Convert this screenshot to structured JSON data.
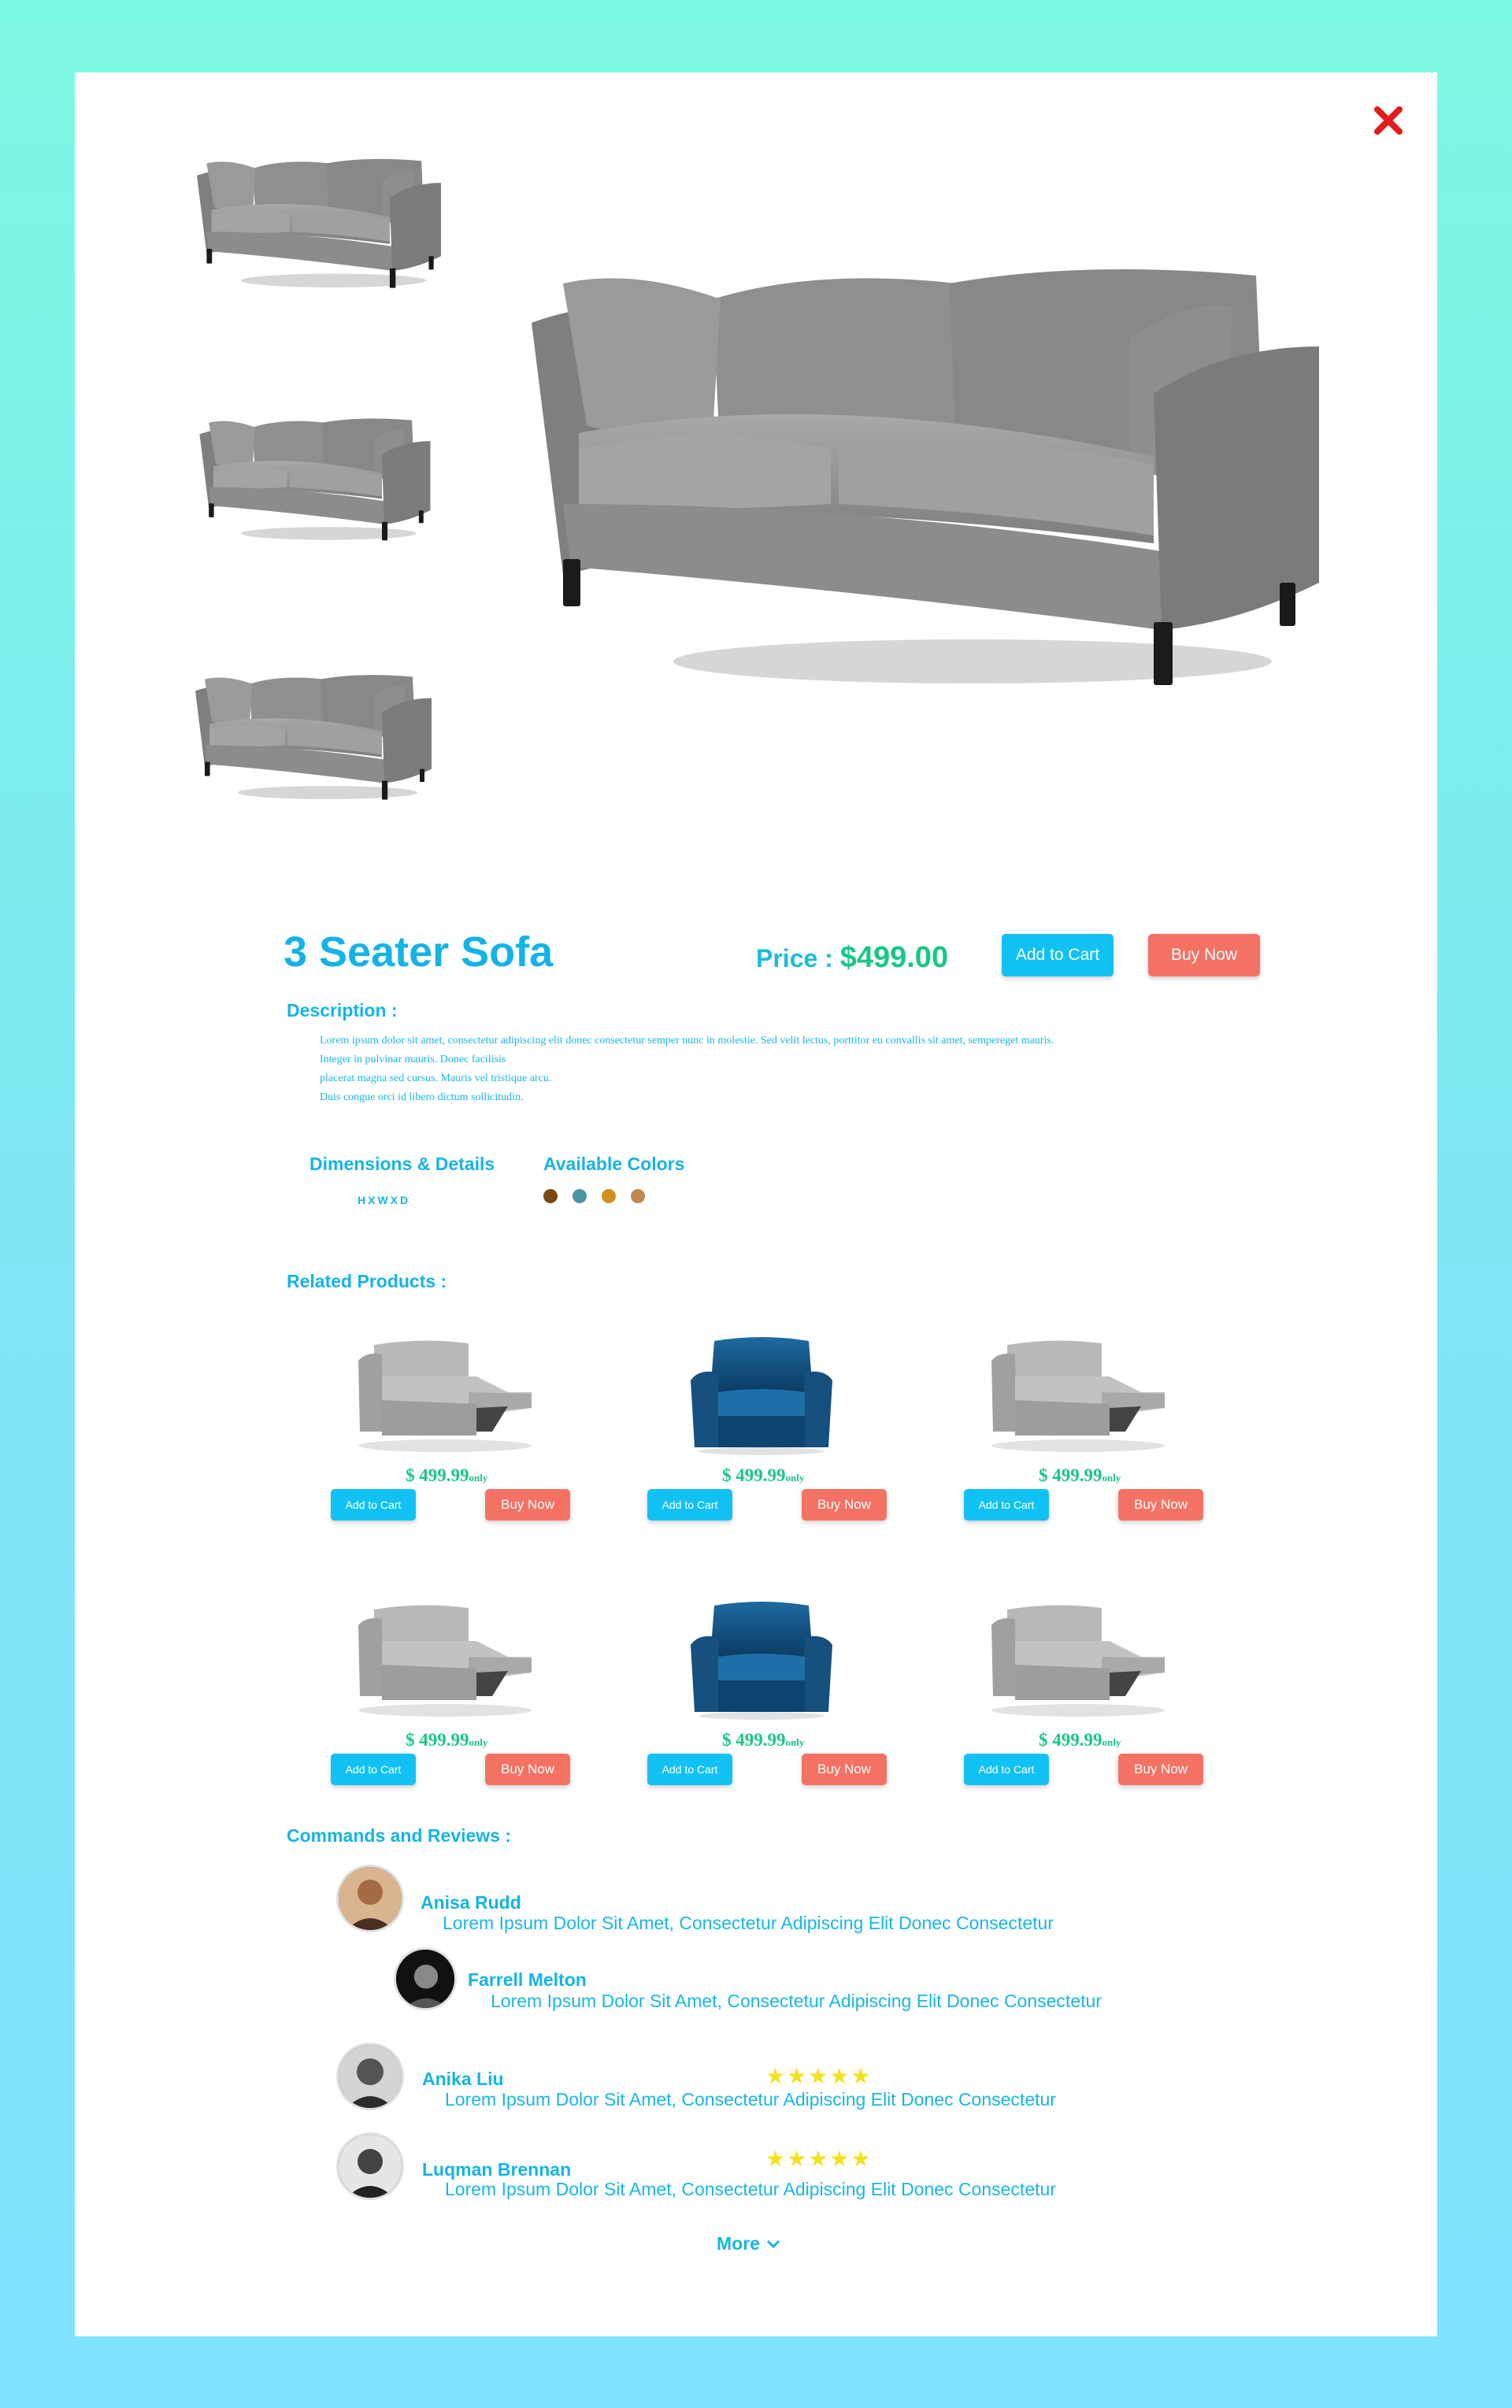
{
  "product": {
    "title": "3 Seater Sofa",
    "price_label": "Price : ",
    "price_value": "$499.00",
    "add_to_cart": "Add to Cart",
    "buy_now": "Buy Now"
  },
  "description": {
    "heading": "Description :",
    "lines": [
      "Lorem ipsum dolor sit amet, consectetur adipiscing elit donec consectetur semper nunc in molestie. Sed velit lectus, porttitor eu convallis sit amet, sempereget mauris.",
      "Integer in pulvinar mauris. Donec facilisis",
      "placerat magna sed cursus. Mauris vel tristique arcu.",
      "Duis congue orci id libero dictum sollicitudin."
    ]
  },
  "details": {
    "dimensions_heading": "Dimensions & Details",
    "dimensions_value": "HXWXD",
    "colors_heading": "Available Colors",
    "colors": [
      "#7a4a14",
      "#4a93a6",
      "#d38f1b",
      "#bf8a52"
    ]
  },
  "related": {
    "heading": "Related Products :",
    "items": [
      {
        "image": "recliner-sofa-grey",
        "price": "$ 499.99",
        "suffix": "only",
        "cart": "Add to Cart",
        "buy": "Buy Now"
      },
      {
        "image": "armchair-blue",
        "price": "$ 499.99",
        "suffix": "only",
        "cart": "Add to Cart",
        "buy": "Buy Now"
      },
      {
        "image": "recliner-sofa-grey",
        "price": "$ 499.99",
        "suffix": "only",
        "cart": "Add to Cart",
        "buy": "Buy Now"
      },
      {
        "image": "recliner-sofa-grey",
        "price": "$ 499.99",
        "suffix": "only",
        "cart": "Add to Cart",
        "buy": "Buy Now"
      },
      {
        "image": "armchair-blue",
        "price": "$ 499.99",
        "suffix": "only",
        "cart": "Add to Cart",
        "buy": "Buy Now"
      },
      {
        "image": "recliner-sofa-grey",
        "price": "$ 499.99",
        "suffix": "only",
        "cart": "Add to Cart",
        "buy": "Buy Now"
      }
    ]
  },
  "reviews": {
    "heading": "Commands and Reviews :",
    "items": [
      {
        "name": "Anisa Rudd",
        "text": "Lorem Ipsum Dolor Sit Amet, Consectetur Adipiscing Elit Donec Consectetur",
        "stars": ""
      },
      {
        "name": "Farrell Melton",
        "text": "Lorem Ipsum Dolor Sit Amet, Consectetur Adipiscing Elit Donec Consectetur",
        "stars": ""
      },
      {
        "name": "Anika Liu",
        "text": "Lorem Ipsum Dolor Sit Amet, Consectetur Adipiscing Elit Donec Consectetur",
        "stars": "★★★★★"
      },
      {
        "name": "Luqman Brennan",
        "text": "Lorem Ipsum Dolor Sit Amet, Consectetur Adipiscing Elit Donec Consectetur",
        "stars": "★★★★★"
      }
    ],
    "more": "More"
  },
  "colors": {
    "accent": "#15b4e4",
    "price": "#19c785",
    "cart": "#12c1f3",
    "buy": "#f47264",
    "close": "#e31b1b"
  }
}
